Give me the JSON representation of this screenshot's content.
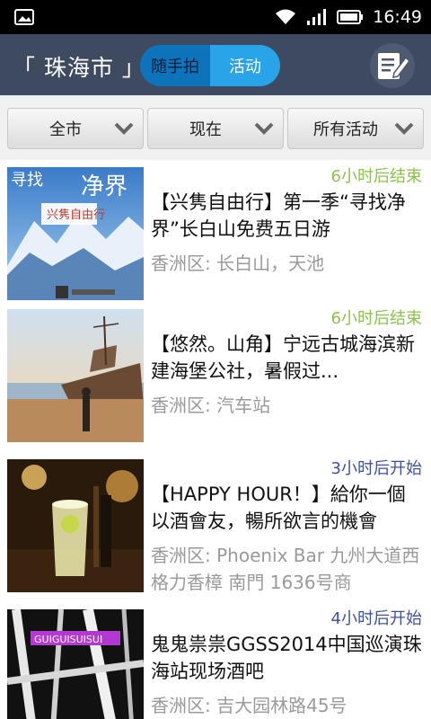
{
  "statusbar": {
    "time": "16:49"
  },
  "header": {
    "city": "「 珠海市 」",
    "tabs": [
      {
        "label": "随手拍",
        "active": false
      },
      {
        "label": "活动",
        "active": true
      }
    ]
  },
  "filters": [
    {
      "label": "全市"
    },
    {
      "label": "现在"
    },
    {
      "label": "所有活动"
    }
  ],
  "events": [
    {
      "status": "6小时后结束",
      "title": "【兴隽自由行】第一季“寻找净界”长白山免费五日游",
      "location": "香洲区: 长白山，天池",
      "image_text": [
        "寻找",
        "净界",
        "兴隽自由行"
      ]
    },
    {
      "status": "6小时后结束",
      "title": "【悠然。山角】宁远古城海滨新建海堡公社，暑假过...",
      "location": "香洲区: 汽车站"
    },
    {
      "status": "3小时后开始",
      "title": "【HAPPY HOUR！】給你一個以酒會友，暢所欲言的機會",
      "location": "香洲区: Phoenix Bar  九州大道西格力香樟 南門 1636号商"
    },
    {
      "status": "4小时后开始",
      "title": "鬼鬼祟祟GGSS2014中国巡演珠海站现场酒吧",
      "location": "香洲区: 吉大园林路45号",
      "image_text": [
        "GUIGUISUISUI"
      ]
    }
  ],
  "colors": {
    "titlebar": "#3d4a5f",
    "accent": "#2aa4e8",
    "status_ending": "#8ac44a",
    "status_starting": "#3c51a8"
  }
}
